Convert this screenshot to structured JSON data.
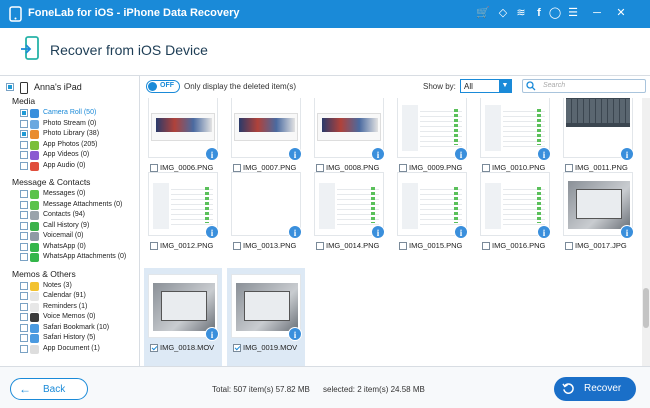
{
  "app": {
    "title": "FoneLab for iOS - iPhone Data Recovery"
  },
  "header": {
    "title": "Recover from iOS Device"
  },
  "sidebar": {
    "device": "Anna's iPad",
    "sections": [
      {
        "title": "Media",
        "items": [
          {
            "label": "Camera Roll (50)",
            "icon": "camera-icon",
            "color": "#3a8fdc",
            "active": true,
            "state": "partial"
          },
          {
            "label": "Photo Stream (0)",
            "icon": "photo-stream-icon",
            "color": "#6aa8e0",
            "state": "none"
          },
          {
            "label": "Photo Library (38)",
            "icon": "photo-library-icon",
            "color": "#e98c2f",
            "state": "partial"
          },
          {
            "label": "App Photos (205)",
            "icon": "app-photos-icon",
            "color": "#7bbf3a",
            "state": "none"
          },
          {
            "label": "App Videos (0)",
            "icon": "app-videos-icon",
            "color": "#8a5bd1",
            "state": "none"
          },
          {
            "label": "App Audio (0)",
            "icon": "app-audio-icon",
            "color": "#e04e3c",
            "state": "none"
          }
        ]
      },
      {
        "title": "Message & Contacts",
        "items": [
          {
            "label": "Messages (0)",
            "icon": "messages-icon",
            "color": "#5cc34a",
            "state": "none"
          },
          {
            "label": "Message Attachments (0)",
            "icon": "attachments-icon",
            "color": "#5cc34a",
            "state": "none"
          },
          {
            "label": "Contacts (94)",
            "icon": "contacts-icon",
            "color": "#9aa3ab",
            "state": "none"
          },
          {
            "label": "Call History (9)",
            "icon": "call-history-icon",
            "color": "#3bb24a",
            "state": "none"
          },
          {
            "label": "Voicemail (0)",
            "icon": "voicemail-icon",
            "color": "#8f9aa5",
            "state": "none"
          },
          {
            "label": "WhatsApp (0)",
            "icon": "whatsapp-icon",
            "color": "#33b64a",
            "state": "none"
          },
          {
            "label": "WhatsApp Attachments (0)",
            "icon": "whatsapp-attachments-icon",
            "color": "#33b64a",
            "state": "none"
          }
        ]
      },
      {
        "title": "Memos & Others",
        "items": [
          {
            "label": "Notes (3)",
            "icon": "notes-icon",
            "color": "#f2c230",
            "state": "none"
          },
          {
            "label": "Calendar (91)",
            "icon": "calendar-icon",
            "color": "#e5e5e5",
            "state": "none"
          },
          {
            "label": "Reminders (1)",
            "icon": "reminders-icon",
            "color": "#e7e7e7",
            "state": "none"
          },
          {
            "label": "Voice Memos (0)",
            "icon": "voice-memos-icon",
            "color": "#3b3b3b",
            "state": "none"
          },
          {
            "label": "Safari Bookmark (10)",
            "icon": "safari-bookmark-icon",
            "color": "#4a9ae0",
            "state": "none"
          },
          {
            "label": "Safari History (5)",
            "icon": "safari-history-icon",
            "color": "#4a9ae0",
            "state": "none"
          },
          {
            "label": "App Document (1)",
            "icon": "app-document-icon",
            "color": "#dddddd",
            "state": "none"
          }
        ]
      }
    ]
  },
  "toolbar": {
    "toggle_label": "OFF",
    "only_deleted_label": "Only display the deleted item(s)",
    "show_by_label": "Show by:",
    "show_by_value": "All",
    "search_placeholder": "Search"
  },
  "files": [
    {
      "name": "IMG_0006.PNG",
      "kind": "web",
      "selected": false
    },
    {
      "name": "IMG_0007.PNG",
      "kind": "web",
      "selected": false
    },
    {
      "name": "IMG_0008.PNG",
      "kind": "web",
      "selected": false
    },
    {
      "name": "IMG_0009.PNG",
      "kind": "settings",
      "selected": false
    },
    {
      "name": "IMG_0010.PNG",
      "kind": "settings",
      "selected": false
    },
    {
      "name": "IMG_0011.PNG",
      "kind": "keyboard",
      "selected": false
    },
    {
      "name": "IMG_0012.PNG",
      "kind": "settings",
      "selected": false
    },
    {
      "name": "IMG_0013.PNG",
      "kind": "blank",
      "selected": false
    },
    {
      "name": "IMG_0014.PNG",
      "kind": "settings",
      "selected": false
    },
    {
      "name": "IMG_0015.PNG",
      "kind": "settings",
      "selected": false
    },
    {
      "name": "IMG_0016.PNG",
      "kind": "settings",
      "selected": false
    },
    {
      "name": "IMG_0017.JPG",
      "kind": "photo",
      "selected": false
    },
    {
      "name": "IMG_0018.MOV",
      "kind": "photo",
      "selected": true
    },
    {
      "name": "IMG_0019.MOV",
      "kind": "photo",
      "selected": true
    }
  ],
  "footer": {
    "back_label": "Back",
    "total_text": "Total: 507 item(s) 57.82 MB",
    "selected_text": "selected: 2 item(s) 24.58 MB",
    "recover_label": "Recover"
  },
  "colors": {
    "accent": "#1a8ad8",
    "title_bar": "#1a8ad8",
    "recover": "#1a6fc8"
  }
}
